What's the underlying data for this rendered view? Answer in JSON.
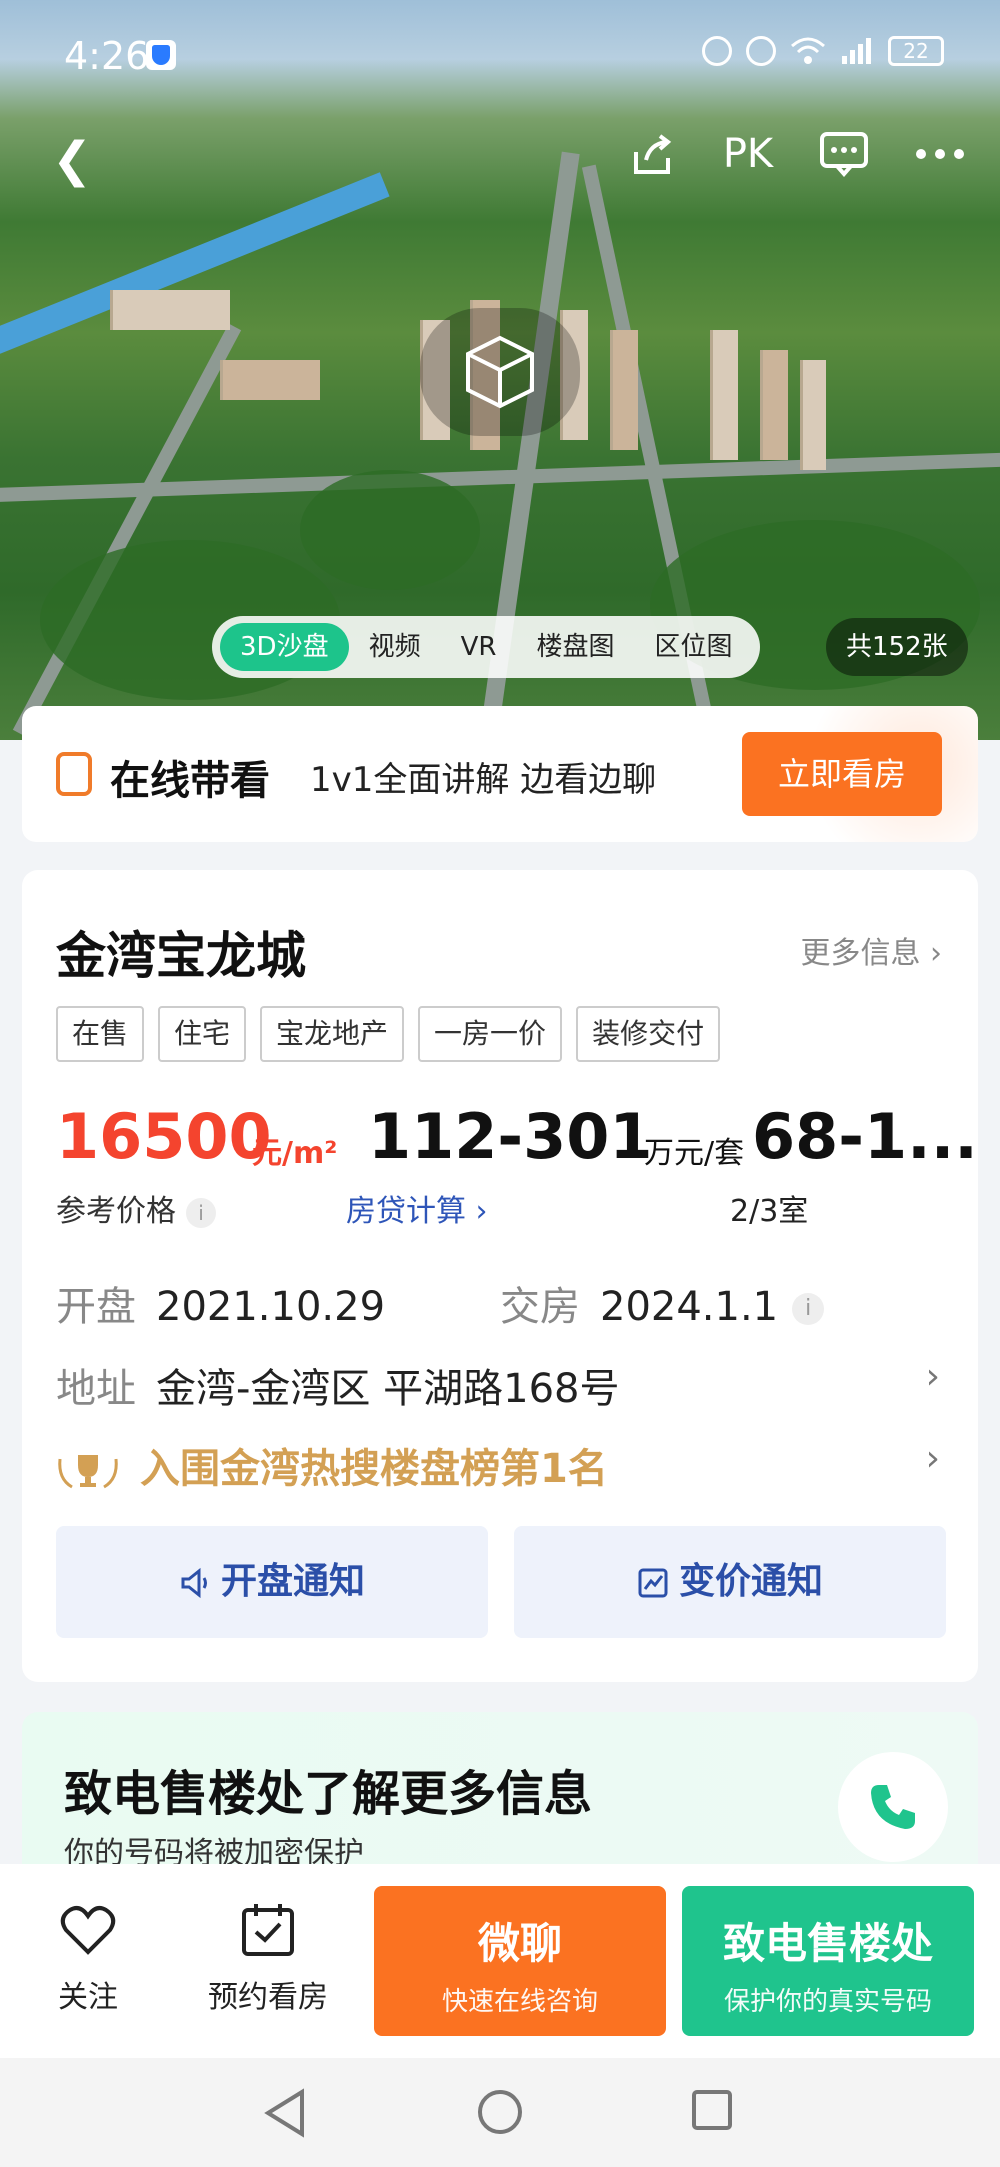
{
  "status_bar": {
    "time": "4:26",
    "battery": "22"
  },
  "nav": {
    "pk": "PK"
  },
  "media_tabs": [
    "3D沙盘",
    "视频",
    "VR",
    "楼盘图",
    "区位图"
  ],
  "photo_count": "共152张",
  "live_viewing": {
    "title": "在线带看",
    "desc": "1v1全面讲解 边看边聊",
    "button": "立即看房"
  },
  "property": {
    "name": "金湾宝龙城",
    "more_info": "更多信息",
    "tags": [
      "在售",
      "住宅",
      "宝龙地产",
      "一房一价",
      "装修交付"
    ],
    "unit_price": "16500",
    "unit_price_unit": "元/m²",
    "total_price": "112-301",
    "total_price_unit": "万元/套",
    "area": "68-1...",
    "ref_price_label": "参考价格",
    "loan_calc": "房贷计算",
    "rooms": "2/3室",
    "open_label": "开盘",
    "open_date": "2021.10.29",
    "deliver_label": "交房",
    "deliver_date": "2024.1.1",
    "address_label": "地址",
    "address": "金湾-金湾区 平湖路168号",
    "rank": "入围金湾热搜楼盘榜第1名",
    "notify_open": "开盘通知",
    "notify_price": "变价通知"
  },
  "call_card": {
    "title": "致电售楼处了解更多信息",
    "subtitle": "你的号码将被加密保护"
  },
  "bottom_bar": {
    "follow": "关注",
    "appointment": "预约看房",
    "wechat_title": "微聊",
    "wechat_sub": "快速在线咨询",
    "call_title": "致电售楼处",
    "call_sub": "保护你的真实号码"
  },
  "colors": {
    "accent_green": "#1fc48d",
    "accent_orange": "#fb7221",
    "price_red": "#f4442e",
    "link_blue": "#2e55b8",
    "gold": "#d3a054"
  }
}
